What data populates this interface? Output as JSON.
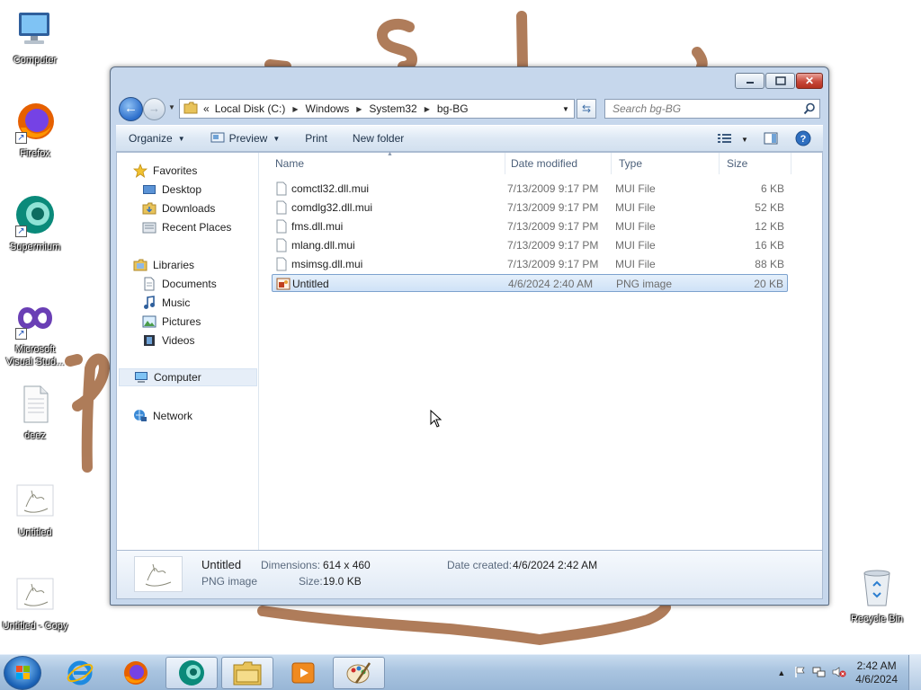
{
  "desktop": {
    "icons": [
      {
        "label": "Computer",
        "icon": "computer-icon"
      },
      {
        "label": "Firefox",
        "icon": "firefox-icon"
      },
      {
        "label": "Supermium",
        "icon": "supermium-icon"
      },
      {
        "label": "Microsoft Visual Stud...",
        "icon": "visual-studio-icon"
      },
      {
        "label": "deez",
        "icon": "text-file-icon"
      },
      {
        "label": "Untitled",
        "icon": "image-file-icon"
      },
      {
        "label": "Untitled - Copy",
        "icon": "image-file-icon"
      },
      {
        "label": "Recycle Bin",
        "icon": "recycle-bin-icon"
      }
    ]
  },
  "window": {
    "breadcrumb": {
      "overflow": "«",
      "items": [
        "Local Disk (C:)",
        "Windows",
        "System32",
        "bg-BG"
      ]
    },
    "search": {
      "placeholder": "Search bg-BG"
    },
    "toolbar": {
      "organize": "Organize",
      "preview": "Preview",
      "print": "Print",
      "new_folder": "New folder"
    },
    "navpane": {
      "favorites": "Favorites",
      "desktop": "Desktop",
      "downloads": "Downloads",
      "recent": "Recent Places",
      "libraries": "Libraries",
      "documents": "Documents",
      "music": "Music",
      "pictures": "Pictures",
      "videos": "Videos",
      "computer": "Computer",
      "network": "Network"
    },
    "columns": {
      "name": "Name",
      "date": "Date modified",
      "type": "Type",
      "size": "Size"
    },
    "files": [
      {
        "name": "comctl32.dll.mui",
        "date": "7/13/2009 9:17 PM",
        "type": "MUI File",
        "size": "6 KB",
        "selected": false
      },
      {
        "name": "comdlg32.dll.mui",
        "date": "7/13/2009 9:17 PM",
        "type": "MUI File",
        "size": "52 KB",
        "selected": false
      },
      {
        "name": "fms.dll.mui",
        "date": "7/13/2009 9:17 PM",
        "type": "MUI File",
        "size": "12 KB",
        "selected": false
      },
      {
        "name": "mlang.dll.mui",
        "date": "7/13/2009 9:17 PM",
        "type": "MUI File",
        "size": "16 KB",
        "selected": false
      },
      {
        "name": "msimsg.dll.mui",
        "date": "7/13/2009 9:17 PM",
        "type": "MUI File",
        "size": "88 KB",
        "selected": false
      },
      {
        "name": "Untitled",
        "date": "4/6/2024 2:40 AM",
        "type": "PNG image",
        "size": "20 KB",
        "selected": true
      }
    ],
    "details": {
      "name": "Untitled",
      "type": "PNG image",
      "dimensions_label": "Dimensions:",
      "dimensions": "614 x 460",
      "size_label": "Size:",
      "size": "19.0 KB",
      "created_label": "Date created:",
      "created": "4/6/2024 2:42 AM"
    }
  },
  "taskbar": {
    "clock_time": "2:42 AM",
    "clock_date": "4/6/2024"
  }
}
